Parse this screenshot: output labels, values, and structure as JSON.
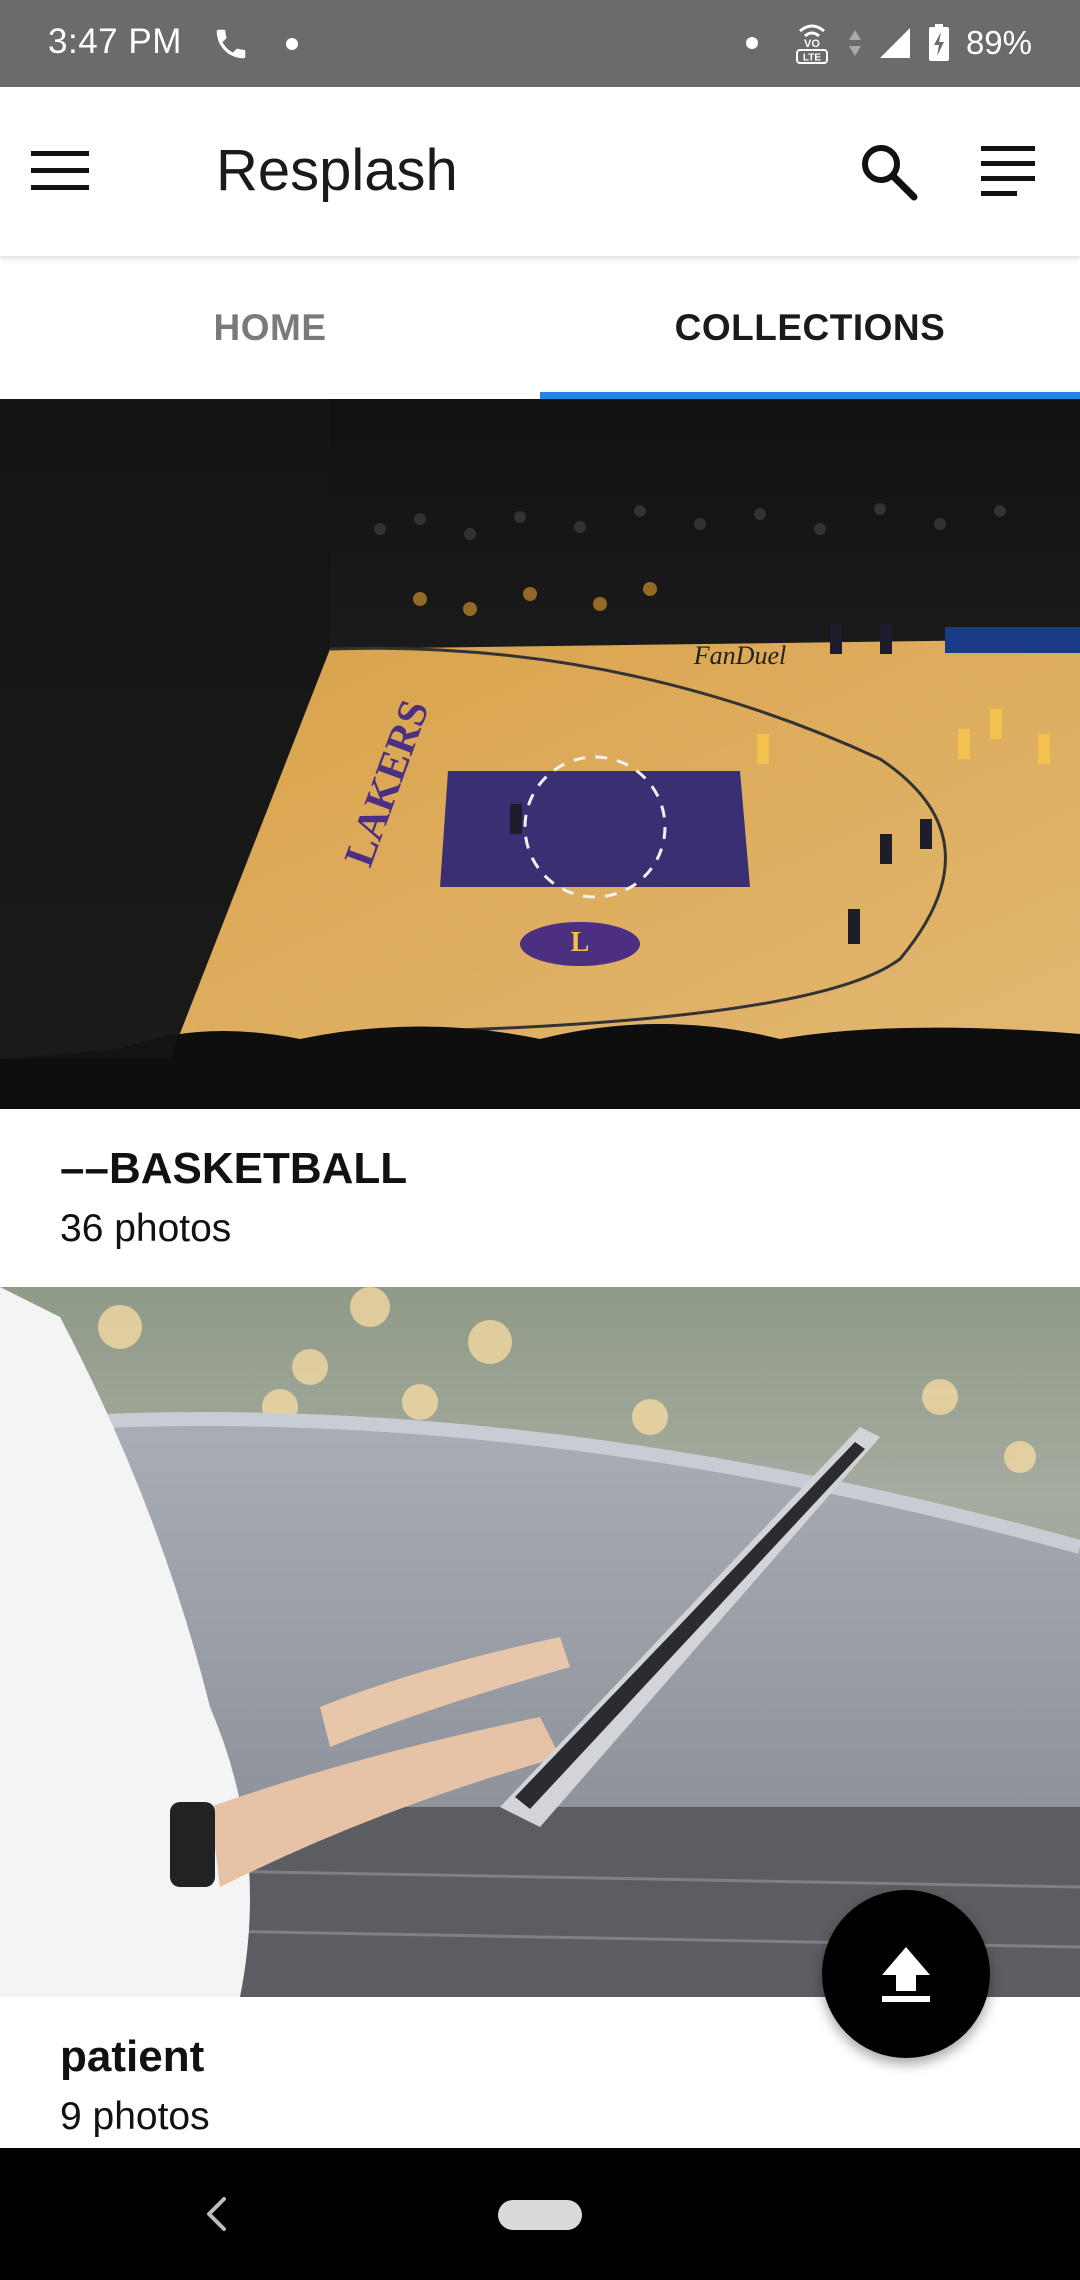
{
  "status_bar": {
    "time": "3:47 PM",
    "battery": "89%",
    "icons": [
      "phone-icon",
      "notification-dot",
      "volte-icon",
      "data-arrows-icon",
      "signal-icon",
      "battery-charging-icon"
    ]
  },
  "app_bar": {
    "title": "Resplash",
    "icons": [
      "menu-icon",
      "search-icon",
      "sort-icon"
    ]
  },
  "tabs": [
    {
      "label": "HOME",
      "active": false
    },
    {
      "label": "COLLECTIONS",
      "active": true
    }
  ],
  "accent_color": "#1e88e5",
  "collections": [
    {
      "title": "––BASKETBALL",
      "count": "36 photos"
    },
    {
      "title": "patient",
      "count": "9 photos"
    }
  ],
  "fab": {
    "icon": "upload-icon"
  },
  "nav_bar": {
    "icons": [
      "back-icon",
      "home-pill"
    ]
  }
}
